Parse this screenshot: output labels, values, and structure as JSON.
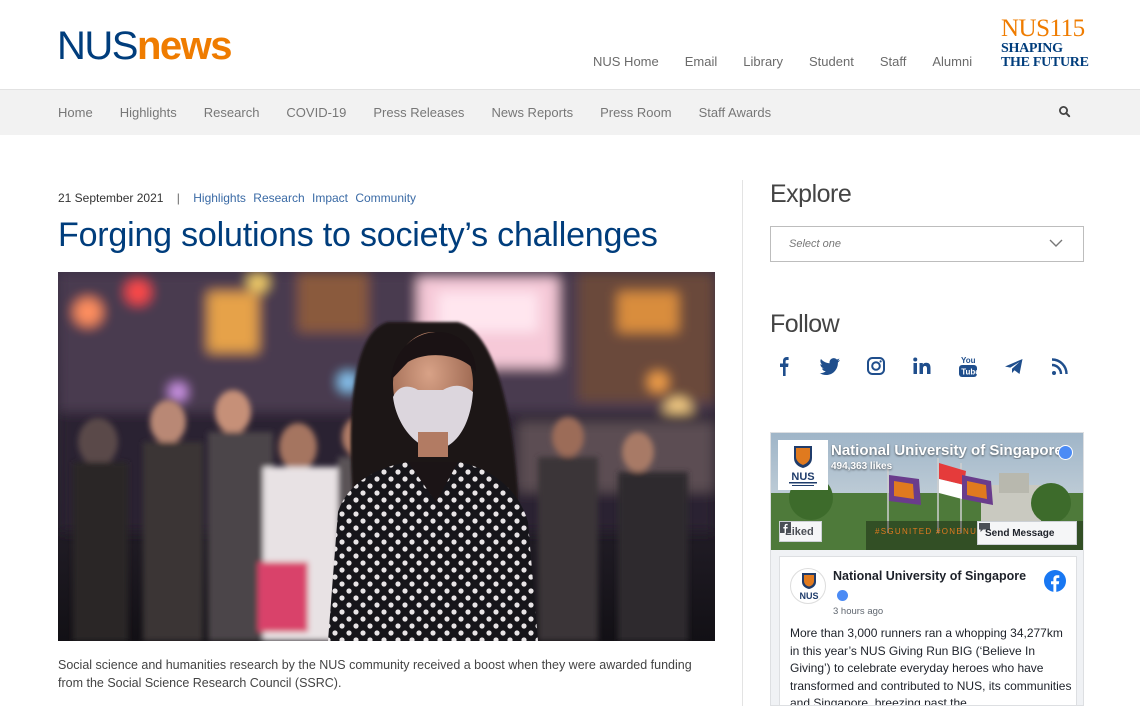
{
  "header": {
    "logo": {
      "part1": "NUS",
      "part2": "news"
    },
    "utility_nav": [
      "NUS Home",
      "Email",
      "Library",
      "Student",
      "Staff",
      "Alumni"
    ],
    "anniversary": {
      "line1": "NUS115",
      "line2": "SHAPING",
      "line3": "THE FUTURE"
    }
  },
  "main_nav": {
    "items": [
      "Home",
      "Highlights",
      "Research",
      "COVID-19",
      "Press Releases",
      "News Reports",
      "Press Room",
      "Staff Awards"
    ],
    "search_icon": "search-icon"
  },
  "article": {
    "date": "21 September 2021",
    "separator": "|",
    "tags": [
      "Highlights",
      "Research",
      "Impact",
      "Community"
    ],
    "title": "Forging solutions to society’s challenges",
    "caption": "Social science and humanities research by the NUS community received a boost when they were awarded funding from the Social Science Research Council (SSRC)."
  },
  "sidebar": {
    "explore_heading": "Explore",
    "explore_placeholder": "Select one",
    "follow_heading": "Follow",
    "social_icons": [
      "facebook-icon",
      "twitter-icon",
      "instagram-icon",
      "linkedin-icon",
      "youtube-icon",
      "telegram-icon",
      "rss-icon"
    ]
  },
  "facebook_widget": {
    "page_name": "National University of Singapore",
    "likes": "494,363 likes",
    "liked_label": "Liked",
    "send_message_label": "Send Message",
    "cover_text": "#SGUNITED #ONENUS",
    "logo_text": "NUS",
    "post": {
      "author": "National University of Singapore",
      "time": "3 hours ago",
      "text": "More than 3,000 runners ran a whopping 34,277km in this year’s NUS Giving Run BIG (‘Believe In Giving’) to celebrate everyday heroes who have transformed and contributed to NUS, its communities and Singapore, breezing past the"
    }
  },
  "colors": {
    "nus_blue": "#003d7c",
    "nus_orange": "#ef7c00",
    "tag_blue": "#3a6aa5",
    "nav_bg": "#f2f2f2",
    "facebook_blue": "#1877f2"
  }
}
